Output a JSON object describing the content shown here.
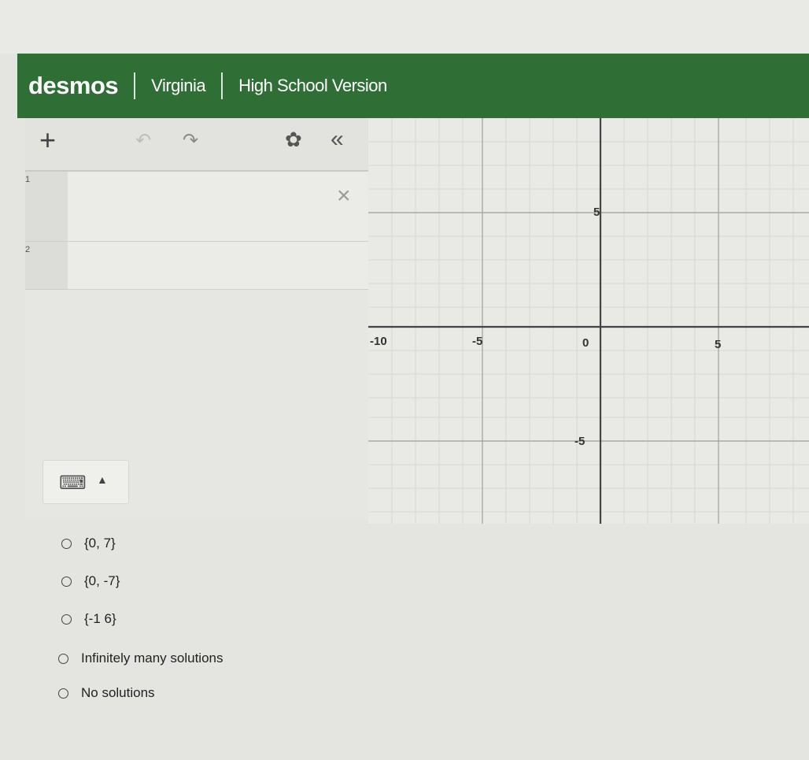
{
  "header": {
    "brand": "desmos",
    "region": "Virginia",
    "version": "High School Version",
    "color": "#2f6e35"
  },
  "toolbar": {
    "add_icon": "plus-icon",
    "undo_icon": "undo-icon",
    "redo_icon": "redo-icon",
    "settings_icon": "gear-icon",
    "collapse_icon": "double-chevron-left-icon"
  },
  "expressions": [
    {
      "index": "1",
      "value": ""
    },
    {
      "index": "2",
      "value": ""
    }
  ],
  "keyboard": {
    "icon": "keyboard-icon",
    "caret_icon": "caret-up-icon"
  },
  "graph": {
    "x_tick_labels": [
      "-10",
      "-5",
      "0",
      "5"
    ],
    "y_tick_labels": [
      "5",
      "-5"
    ],
    "grid": true
  },
  "choices": [
    {
      "label": "{0, 7}"
    },
    {
      "label": "{0, -7}"
    },
    {
      "label": "{-1 6}"
    },
    {
      "label": "Infinitely many solutions"
    },
    {
      "label": "No solutions"
    }
  ]
}
